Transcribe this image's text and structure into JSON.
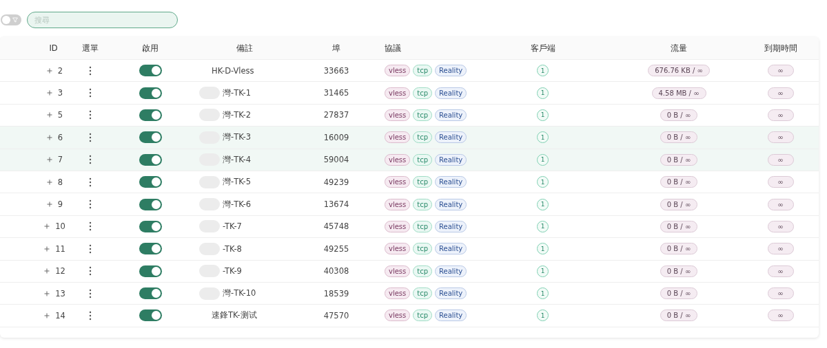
{
  "toolbar": {
    "filter_switch": {
      "on": false
    },
    "search": {
      "placeholder": "搜尋"
    }
  },
  "table": {
    "columns": [
      "ID",
      "選單",
      "啟用",
      "備註",
      "埠",
      "協議",
      "客戶端",
      "流量",
      "到期時間"
    ],
    "rows": [
      {
        "id": "2",
        "enabled": true,
        "remark": "HK-D-Vless",
        "redacted": false,
        "port": "33663",
        "protocols": [
          "vless",
          "tcp",
          "Reality"
        ],
        "clients": "1",
        "traffic": "676.76 KB / ∞",
        "expiry": "∞",
        "highlighted": false
      },
      {
        "id": "3",
        "enabled": true,
        "remark": "灣-TK-1",
        "redacted": true,
        "port": "31465",
        "protocols": [
          "vless",
          "tcp",
          "Reality"
        ],
        "clients": "1",
        "traffic": "4.58 MB / ∞",
        "expiry": "∞",
        "highlighted": false
      },
      {
        "id": "5",
        "enabled": true,
        "remark": "灣-TK-2",
        "redacted": true,
        "port": "27837",
        "protocols": [
          "vless",
          "tcp",
          "Reality"
        ],
        "clients": "1",
        "traffic": "0 B / ∞",
        "expiry": "∞",
        "highlighted": false
      },
      {
        "id": "6",
        "enabled": true,
        "remark": "灣-TK-3",
        "redacted": true,
        "port": "16009",
        "protocols": [
          "vless",
          "tcp",
          "Reality"
        ],
        "clients": "1",
        "traffic": "0 B / ∞",
        "expiry": "∞",
        "highlighted": true
      },
      {
        "id": "7",
        "enabled": true,
        "remark": "灣-TK-4",
        "redacted": true,
        "port": "59004",
        "protocols": [
          "vless",
          "tcp",
          "Reality"
        ],
        "clients": "1",
        "traffic": "0 B / ∞",
        "expiry": "∞",
        "highlighted": true
      },
      {
        "id": "8",
        "enabled": true,
        "remark": "灣-TK-5",
        "redacted": true,
        "port": "49239",
        "protocols": [
          "vless",
          "tcp",
          "Reality"
        ],
        "clients": "1",
        "traffic": "0 B / ∞",
        "expiry": "∞",
        "highlighted": false
      },
      {
        "id": "9",
        "enabled": true,
        "remark": "灣-TK-6",
        "redacted": true,
        "port": "13674",
        "protocols": [
          "vless",
          "tcp",
          "Reality"
        ],
        "clients": "1",
        "traffic": "0 B / ∞",
        "expiry": "∞",
        "highlighted": false
      },
      {
        "id": "10",
        "enabled": true,
        "remark": "-TK-7",
        "redacted": true,
        "port": "45748",
        "protocols": [
          "vless",
          "tcp",
          "Reality"
        ],
        "clients": "1",
        "traffic": "0 B / ∞",
        "expiry": "∞",
        "highlighted": false
      },
      {
        "id": "11",
        "enabled": true,
        "remark": "-TK-8",
        "redacted": true,
        "port": "49255",
        "protocols": [
          "vless",
          "tcp",
          "Reality"
        ],
        "clients": "1",
        "traffic": "0 B / ∞",
        "expiry": "∞",
        "highlighted": false
      },
      {
        "id": "12",
        "enabled": true,
        "remark": "-TK-9",
        "redacted": true,
        "port": "40308",
        "protocols": [
          "vless",
          "tcp",
          "Reality"
        ],
        "clients": "1",
        "traffic": "0 B / ∞",
        "expiry": "∞",
        "highlighted": false
      },
      {
        "id": "13",
        "enabled": true,
        "remark": "灣-TK-10",
        "redacted": true,
        "port": "18539",
        "protocols": [
          "vless",
          "tcp",
          "Reality"
        ],
        "clients": "1",
        "traffic": "0 B / ∞",
        "expiry": "∞",
        "highlighted": false
      },
      {
        "id": "14",
        "enabled": true,
        "remark": "速鋒TK-测试",
        "redacted": false,
        "port": "47570",
        "protocols": [
          "vless",
          "tcp",
          "Reality"
        ],
        "clients": "1",
        "traffic": "0 B / ∞",
        "expiry": "∞",
        "highlighted": false
      }
    ]
  }
}
